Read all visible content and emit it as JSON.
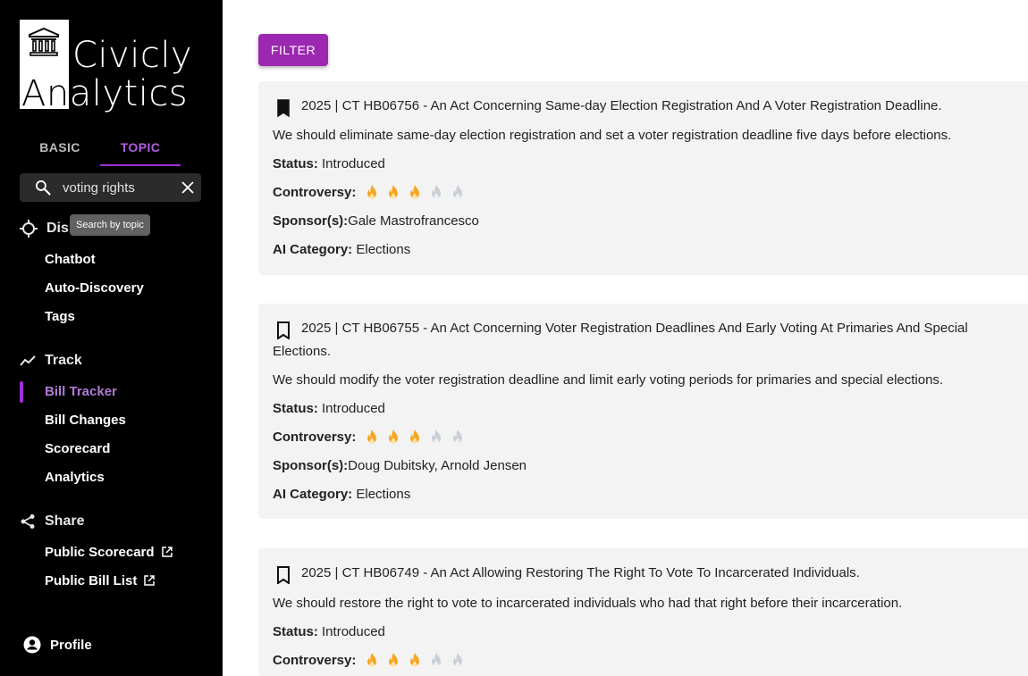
{
  "app": {
    "logo_line1": "Civicly",
    "logo_line2_dark": "An",
    "logo_line2_light": "alytics"
  },
  "tabs": [
    {
      "label": "BASIC",
      "active": false
    },
    {
      "label": "TOPIC",
      "active": true
    }
  ],
  "search": {
    "value": "voting rights",
    "tooltip": "Search by topic"
  },
  "nav": {
    "discover": {
      "label": "Discover",
      "visible_label": "Dis",
      "items": [
        "Chatbot",
        "Auto-Discovery",
        "Tags"
      ]
    },
    "track": {
      "label": "Track",
      "items": [
        "Bill Tracker",
        "Bill Changes",
        "Scorecard",
        "Analytics"
      ],
      "active_item": "Bill Tracker"
    },
    "share": {
      "label": "Share",
      "items": [
        "Public Scorecard",
        "Public Bill List"
      ]
    },
    "profile": "Profile"
  },
  "toolbar": {
    "filter_label": "FILTER"
  },
  "labels": {
    "status": "Status:",
    "controversy": "Controversy:",
    "sponsors": "Sponsor(s):",
    "ai_category": "AI Category:"
  },
  "bills": [
    {
      "title": "2025 | CT HB06756 - An Act Concerning Same-day Election Registration And A Voter Registration Deadline.",
      "summary": "We should eliminate same-day election registration and set a voter registration deadline five days before elections.",
      "status": "Introduced",
      "controversy": 3,
      "controversy_max": 5,
      "sponsors": "Gale Mastrofrancesco",
      "ai_category": "Elections",
      "bookmarked": true
    },
    {
      "title": "2025 | CT HB06755 - An Act Concerning Voter Registration Deadlines And Early Voting At Primaries And Special Elections.",
      "summary": "We should modify the voter registration deadline and limit early voting periods for primaries and special elections.",
      "status": "Introduced",
      "controversy": 3,
      "controversy_max": 5,
      "sponsors": "Doug Dubitsky, Arnold Jensen",
      "ai_category": "Elections",
      "bookmarked": false
    },
    {
      "title": "2025 | CT HB06749 - An Act Allowing Restoring The Right To Vote To Incarcerated Individuals.",
      "summary": "We should restore the right to vote to incarcerated individuals who had that right before their incarceration.",
      "status": "Introduced",
      "controversy": 3,
      "controversy_max": 5,
      "bookmarked": false
    }
  ],
  "colors": {
    "accent": "#9c27b0",
    "flame_active": "#f5a623",
    "flame_inactive": "#c9cfd6"
  }
}
